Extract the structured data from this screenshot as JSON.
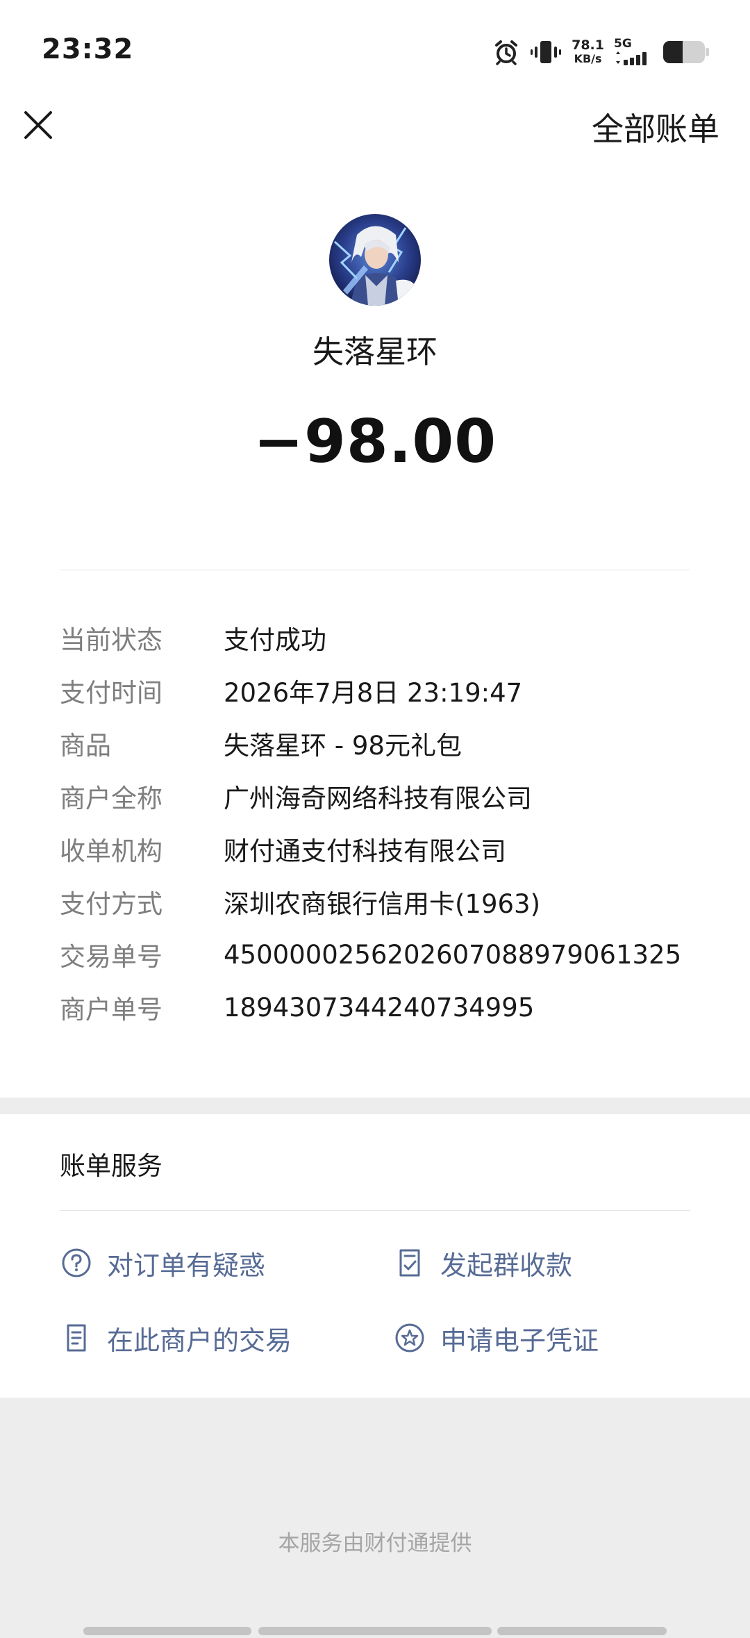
{
  "status_bar": {
    "time": "23:32",
    "net_speed_value": "78.1",
    "net_speed_unit": "KB/s",
    "network_type": "5G",
    "icons": [
      "alarm-icon",
      "vibrate-icon",
      "signal-icon",
      "battery-icon"
    ]
  },
  "header": {
    "close_icon": "close-icon",
    "all_bills_label": "全部账单"
  },
  "merchant": {
    "name": "失落星环",
    "amount": "−98.00"
  },
  "details": [
    {
      "label": "当前状态",
      "value": "支付成功"
    },
    {
      "label": "支付时间",
      "value": "2026年7月8日 23:19:47"
    },
    {
      "label": "商品",
      "value": "失落星环 - 98元礼包"
    },
    {
      "label": "商户全称",
      "value": "广州海奇网络科技有限公司"
    },
    {
      "label": "收单机构",
      "value": "财付通支付科技有限公司"
    },
    {
      "label": "支付方式",
      "value": "深圳农商银行信用卡(1963)"
    },
    {
      "label": "交易单号",
      "value": "4500000256202607088979061325"
    },
    {
      "label": "商户单号",
      "value": "1894307344240734995"
    }
  ],
  "bill_service": {
    "title": "账单服务",
    "items": [
      {
        "label": "对订单有疑惑",
        "icon": "question-circle-icon"
      },
      {
        "label": "发起群收款",
        "icon": "checklist-icon"
      },
      {
        "label": "在此商户的交易",
        "icon": "document-icon"
      },
      {
        "label": "申请电子凭证",
        "icon": "star-badge-icon"
      }
    ]
  },
  "footer": {
    "text": "本服务由财付通提供"
  },
  "colors": {
    "link": "#576b95",
    "label": "#7e7e7e",
    "background": "#ededed"
  }
}
